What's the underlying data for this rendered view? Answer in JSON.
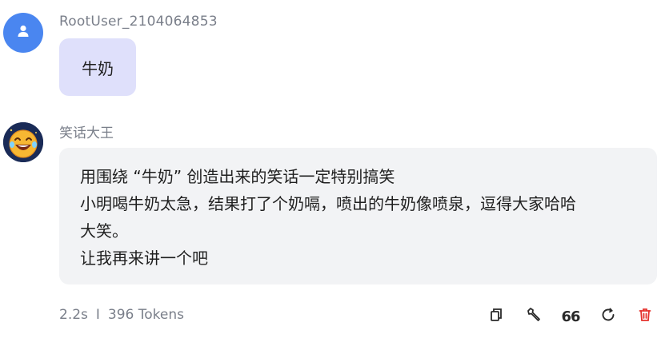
{
  "user_message": {
    "username": "RootUser_2104064853",
    "text": "牛奶",
    "avatar_icon": "user-icon"
  },
  "bot_message": {
    "name": "笑话大王",
    "avatar_icon": "laughing-emoji-icon",
    "lines": [
      "用围绕 “牛奶” 创造出来的笑话一定特别搞笑",
      "小明喝牛奶太急，结果打了个奶嗝，喷出的牛奶像喷泉，逗得大家哈哈",
      "大笑。",
      "让我再来讲一个吧"
    ]
  },
  "meta": {
    "duration": "2.2s",
    "separator": "I",
    "tokens": "396 Tokens"
  },
  "actions": {
    "copy_icon": "copy-icon",
    "edit_icon": "wrench-icon",
    "quote_label": "66",
    "regenerate_icon": "refresh-icon",
    "delete_icon": "trash-icon",
    "delete_color": "#e5322d"
  },
  "colors": {
    "user_avatar_bg": "#4a86f0",
    "user_bubble_bg": "#dfe0fb",
    "bot_bubble_bg": "#f2f3f5",
    "muted_text": "#7a7f8a"
  }
}
